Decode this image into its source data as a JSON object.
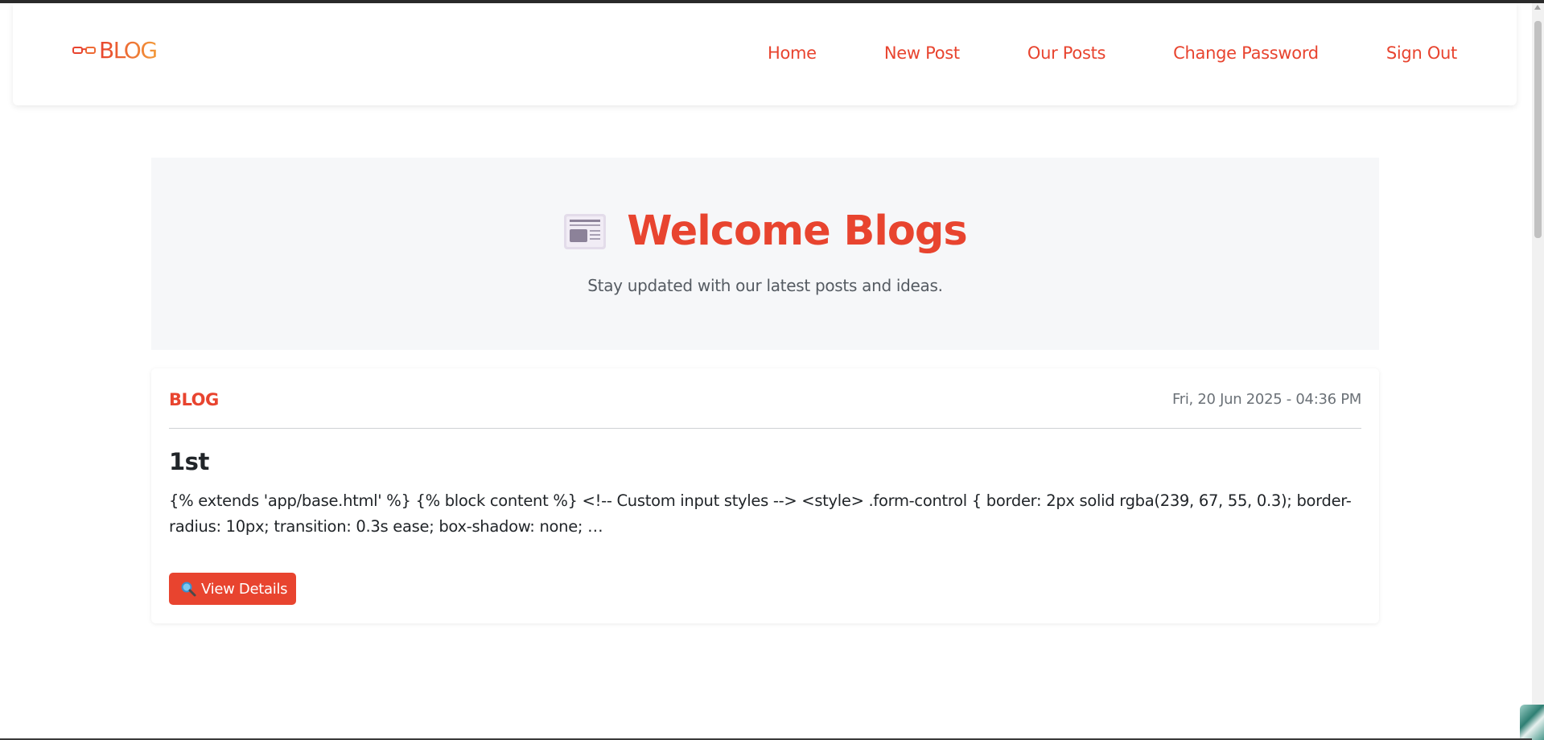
{
  "navbar": {
    "brand_label": "BLOG",
    "brand_icon": "glasses-icon",
    "links": [
      {
        "label": "Home"
      },
      {
        "label": "New Post"
      },
      {
        "label": "Our Posts"
      },
      {
        "label": "Change Password"
      },
      {
        "label": "Sign Out"
      }
    ]
  },
  "hero": {
    "icon": "newspaper-icon",
    "title": "Welcome Blogs",
    "subtitle": "Stay updated with our latest posts and ideas."
  },
  "post": {
    "category": "BLOG",
    "date": "Fri, 20 Jun 2025 - 04:36 PM",
    "title": "1st",
    "excerpt": "{% extends 'app/base.html' %} {% block content %} <!-- Custom input styles --> <style> .form-control { border: 2px solid rgba(239, 67, 55, 0.3); border-radius: 10px; transition: 0.3s ease; box-shadow: none; …",
    "button_label": "View Details",
    "button_icon": "magnifying-glass-icon"
  },
  "colors": {
    "accent": "#e8442f",
    "hero_bg": "#f6f7f9",
    "text_dark": "#212529",
    "text_muted": "#6b7177"
  }
}
